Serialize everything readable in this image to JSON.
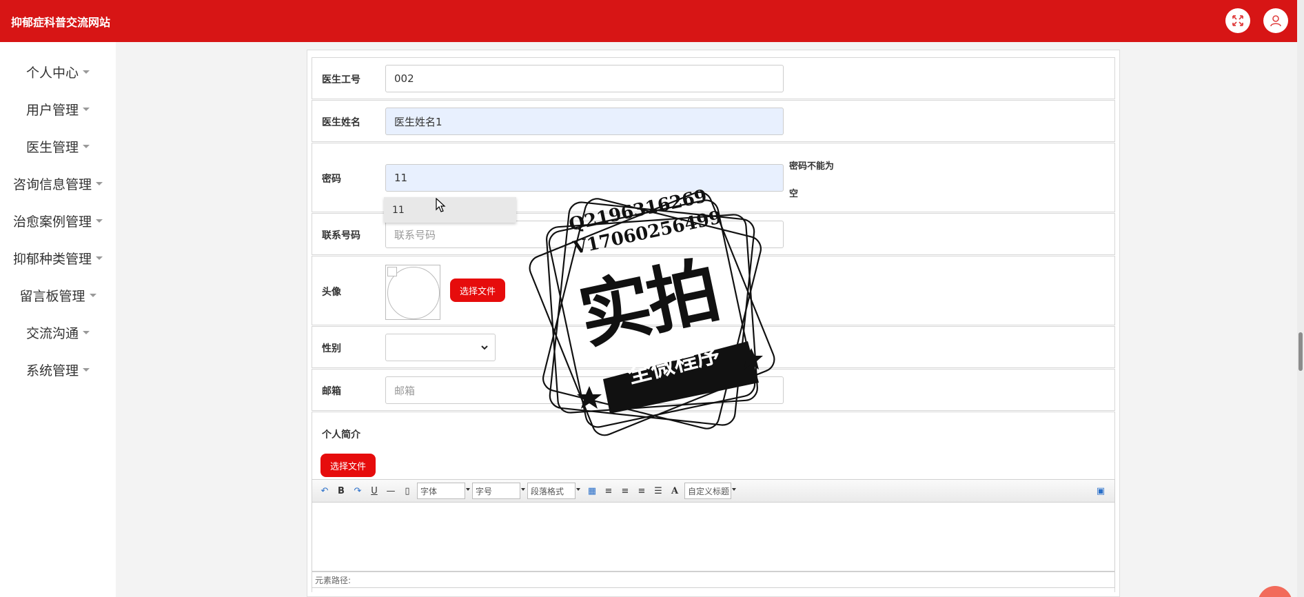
{
  "header": {
    "title": "抑郁症科普交流网站",
    "fullscreen_icon": "fullscreen-icon",
    "user_icon": "user-icon"
  },
  "sidebar": {
    "items": [
      {
        "label": "个人中心"
      },
      {
        "label": "用户管理"
      },
      {
        "label": "医生管理"
      },
      {
        "label": "咨询信息管理"
      },
      {
        "label": "治愈案例管理"
      },
      {
        "label": "抑郁种类管理"
      },
      {
        "label": "留言板管理"
      },
      {
        "label": "交流沟通"
      },
      {
        "label": "系统管理"
      }
    ]
  },
  "form": {
    "doctor_id": {
      "label": "医生工号",
      "value": "002"
    },
    "doctor_name": {
      "label": "医生姓名",
      "value": "医生姓名1"
    },
    "password": {
      "label": "密码",
      "value": "11",
      "error_line1": "密码不能为",
      "error_line2": "空",
      "suggestion": "11"
    },
    "phone": {
      "label": "联系号码",
      "placeholder": "联系号码"
    },
    "avatar": {
      "label": "头像",
      "button": "选择文件"
    },
    "gender": {
      "label": "性别",
      "value": ""
    },
    "email": {
      "label": "邮箱",
      "placeholder": "邮箱"
    },
    "bio": {
      "label": "个人简介",
      "button": "选择文件",
      "toolbar": {
        "font": "字体",
        "size": "字号",
        "paragraph": "段落格式",
        "custom_title": "自定义标题",
        "bold": "B",
        "underline": "U",
        "font_color": "A"
      },
      "element_path": "元素路径:"
    }
  },
  "watermark": {
    "line1": "Q2196316269",
    "line2": "V17060256499",
    "main": "实拍",
    "banner": "全微程序"
  }
}
